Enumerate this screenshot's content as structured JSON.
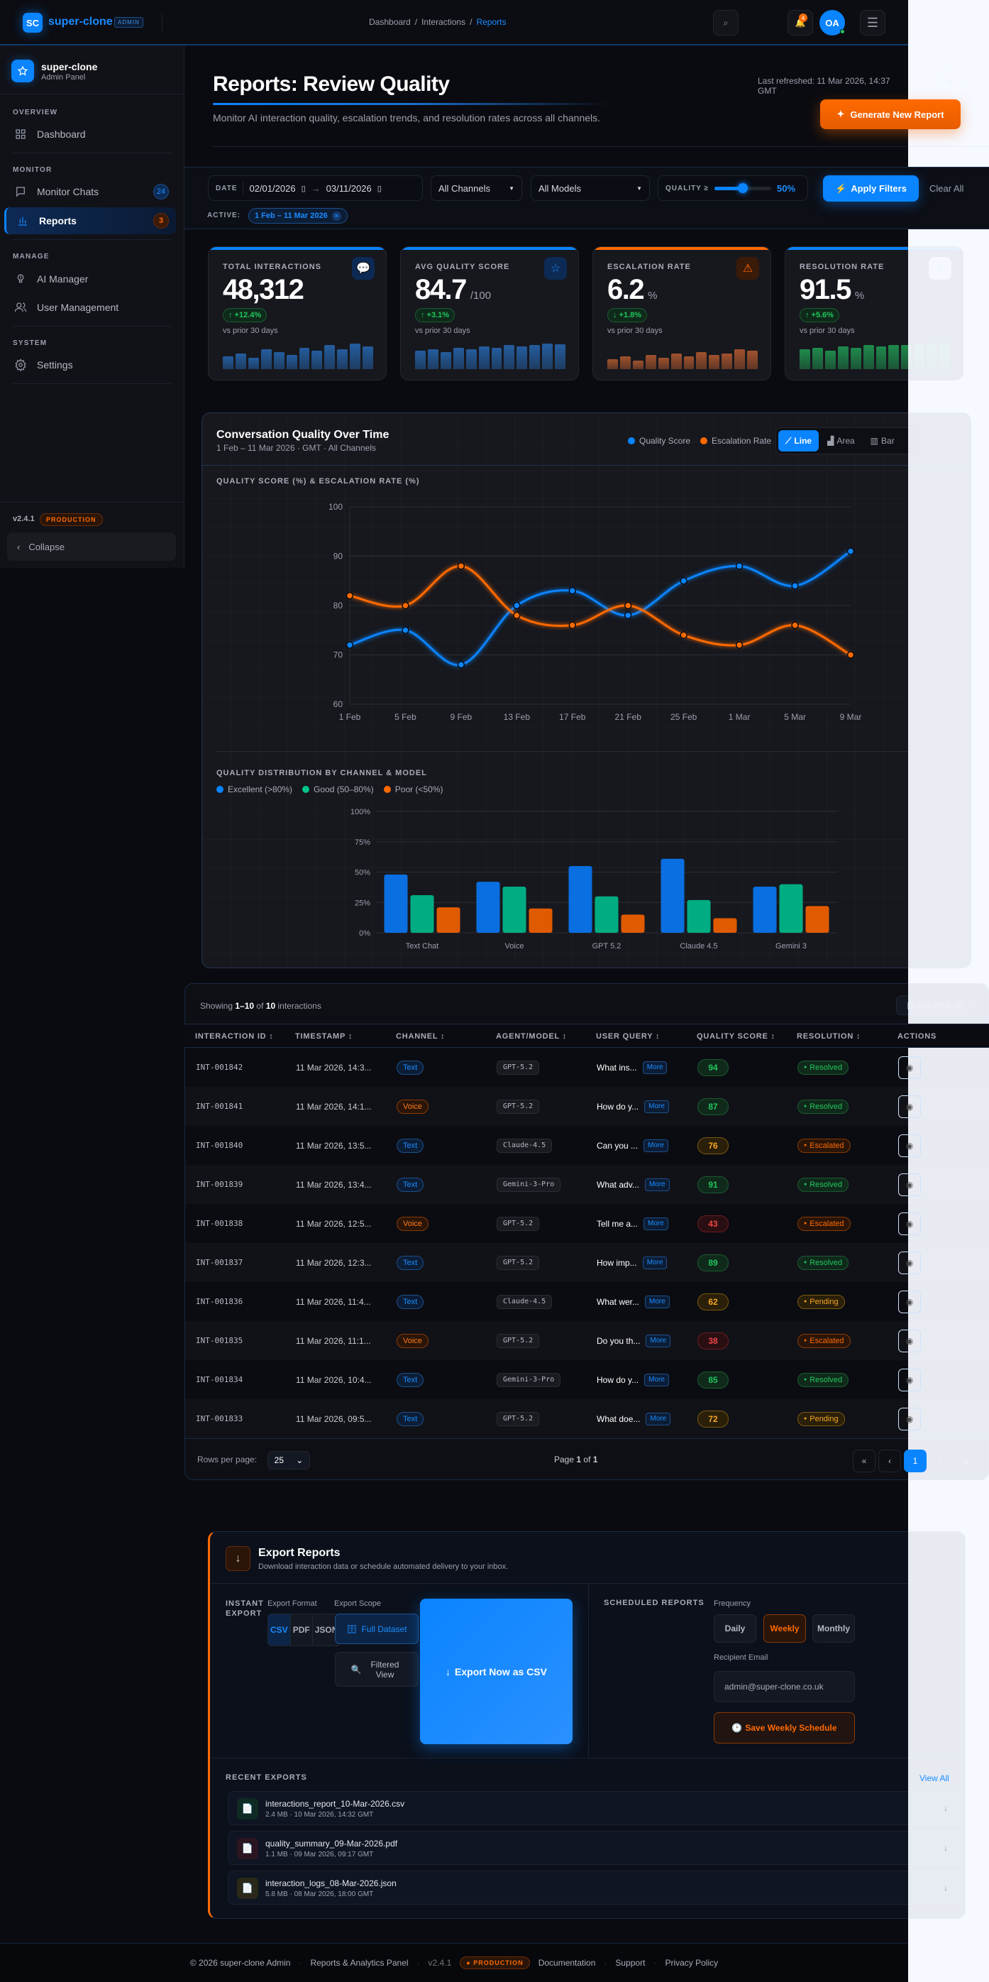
{
  "header": {
    "logo": "SC",
    "brand": "super-clone",
    "badge": "ADMIN",
    "breadcrumb": [
      "Dashboard",
      "Interactions",
      "Reports"
    ],
    "notifications": "4",
    "avatar": "OA"
  },
  "sidebar": {
    "brand": "super-clone",
    "subtitle": "Admin Panel",
    "sections": [
      "OVERVIEW",
      "MONITOR",
      "MANAGE",
      "SYSTEM"
    ],
    "items": [
      {
        "label": "Dashboard",
        "icon": "grid-icon"
      },
      {
        "label": "Monitor Chats",
        "icon": "chat-icon",
        "badge": "24"
      },
      {
        "label": "Reports",
        "icon": "bar-chart-icon",
        "badge": "3",
        "active": true
      },
      {
        "label": "AI Manager",
        "icon": "robot-icon"
      },
      {
        "label": "User Management",
        "icon": "users-icon"
      },
      {
        "label": "Settings",
        "icon": "gear-icon"
      }
    ],
    "version": "v2.4.1",
    "env": "PRODUCTION",
    "collapse": "Collapse"
  },
  "page": {
    "title": "Reports: Review Quality",
    "subtitle": "Monitor AI interaction quality, escalation trends, and resolution rates across all channels.",
    "last_refreshed": "Last refreshed: 11 Mar 2026, 14:37 GMT",
    "generate": "Generate New Report"
  },
  "filters": {
    "date_label": "DATE",
    "date_from": "02/01/2026",
    "date_to": "03/11/2026",
    "channel": "All Channels",
    "model": "All Models",
    "quality_label": "QUALITY ≥",
    "quality_value": "50%",
    "quality_fraction": 0.5,
    "apply": "Apply Filters",
    "clear": "Clear All",
    "active_label": "ACTIVE:",
    "active_chip": "1 Feb – 11 Mar 2026"
  },
  "stats": [
    {
      "title": "TOTAL INTERACTIONS",
      "value": "48,312",
      "unit": "",
      "delta": "↑ +12.4%",
      "prior": "vs prior 30 days",
      "accent": "#0a84ff",
      "sparkline": [
        52,
        64,
        46,
        82,
        70,
        58,
        88,
        76,
        100,
        82,
        106,
        94
      ]
    },
    {
      "title": "AVG QUALITY SCORE",
      "value": "84.7",
      "unit": "/100",
      "delta": "↑ +3.1%",
      "prior": "vs prior 30 days",
      "accent": "#0a84ff",
      "sparkline": [
        76,
        82,
        70,
        88,
        82,
        94,
        88,
        100,
        94,
        100,
        106,
        103
      ]
    },
    {
      "title": "ESCALATION RATE",
      "value": "6.2",
      "unit": "%",
      "delta": "↓ +1.8%",
      "prior": "vs prior 30 days",
      "accent": "#ff6a00",
      "sparkline": [
        40,
        52,
        34,
        58,
        46,
        64,
        52,
        70,
        58,
        64,
        82,
        76
      ]
    },
    {
      "title": "RESOLUTION RATE",
      "value": "91.5",
      "unit": "%",
      "delta": "↑ +5.6%",
      "prior": "vs prior 30 days",
      "accent": "#0a84ff",
      "sparkline": [
        82,
        88,
        76,
        94,
        88,
        100,
        94,
        100,
        100,
        103,
        106,
        106
      ]
    }
  ],
  "chart_panel": {
    "title": "Conversation Quality Over Time",
    "subtitle": "1 Feb – 11 Mar 2026 · GMT · All Channels",
    "toggles": [
      "Line",
      "Area",
      "Bar"
    ],
    "active_toggle": "Line"
  },
  "chart_data": [
    {
      "type": "line",
      "title": "QUALITY SCORE (%) & ESCALATION RATE (%)",
      "x": [
        "1 Feb",
        "5 Feb",
        "9 Feb",
        "13 Feb",
        "17 Feb",
        "21 Feb",
        "25 Feb",
        "1 Mar",
        "5 Mar",
        "9 Mar"
      ],
      "ylim": [
        60,
        100
      ],
      "yticks": [
        60,
        70,
        80,
        90,
        100
      ],
      "grid": true,
      "legend": "top-right",
      "series": [
        {
          "name": "Quality Score",
          "color": "#0a84ff",
          "values": [
            72,
            75,
            68,
            80,
            83,
            78,
            85,
            88,
            84,
            91
          ]
        },
        {
          "name": "Escalation Rate",
          "color": "#ff6a00",
          "values": [
            82,
            80,
            88,
            78,
            76,
            80,
            74,
            72,
            76,
            70
          ]
        }
      ]
    },
    {
      "type": "bar",
      "title": "QUALITY DISTRIBUTION BY CHANNEL & MODEL",
      "categories": [
        "Text Chat",
        "Voice",
        "GPT 5.2",
        "Claude 4.5",
        "Gemini 3"
      ],
      "ylim": [
        0,
        100
      ],
      "yticks": [
        "0%",
        "25%",
        "50%",
        "75%",
        "100%"
      ],
      "legend": "top-left",
      "series": [
        {
          "name": "Excellent (>80%)",
          "color": "#0a6fe0",
          "values": [
            48,
            42,
            55,
            61,
            38
          ]
        },
        {
          "name": "Good (50–80%)",
          "color": "#00ad82",
          "values": [
            31,
            38,
            30,
            27,
            40
          ]
        },
        {
          "name": "Poor (<50%)",
          "color": "#e05a00",
          "values": [
            21,
            20,
            15,
            12,
            22
          ]
        }
      ]
    }
  ],
  "table": {
    "showing_prefix": "Showing",
    "showing_range": "1–10",
    "showing_of": "of",
    "showing_total": "10",
    "showing_suffix": "interactions",
    "columns_button": "Columns (8)",
    "columns": [
      "INTERACTION ID",
      "TIMESTAMP",
      "CHANNEL",
      "AGENT/MODEL",
      "USER QUERY",
      "QUALITY SCORE",
      "RESOLUTION",
      "ACTIONS"
    ],
    "more": "More",
    "rows": [
      {
        "id": "INT-001842",
        "time": "11 Mar 2026, 14:3...",
        "channel": "Text",
        "model": "GPT-5.2",
        "query": "What ins...",
        "score": 94,
        "resolution": "Resolved"
      },
      {
        "id": "INT-001841",
        "time": "11 Mar 2026, 14:1...",
        "channel": "Voice",
        "model": "GPT-5.2",
        "query": "How do y...",
        "score": 87,
        "resolution": "Resolved"
      },
      {
        "id": "INT-001840",
        "time": "11 Mar 2026, 13:5...",
        "channel": "Text",
        "model": "Claude-4.5",
        "query": "Can you ...",
        "score": 76,
        "resolution": "Escalated"
      },
      {
        "id": "INT-001839",
        "time": "11 Mar 2026, 13:4...",
        "channel": "Text",
        "model": "Gemini-3-Pro",
        "query": "What adv...",
        "score": 91,
        "resolution": "Resolved"
      },
      {
        "id": "INT-001838",
        "time": "11 Mar 2026, 12:5...",
        "channel": "Voice",
        "model": "GPT-5.2",
        "query": "Tell me a...",
        "score": 43,
        "resolution": "Escalated"
      },
      {
        "id": "INT-001837",
        "time": "11 Mar 2026, 12:3...",
        "channel": "Text",
        "model": "GPT-5.2",
        "query": "How imp...",
        "score": 89,
        "resolution": "Resolved"
      },
      {
        "id": "INT-001836",
        "time": "11 Mar 2026, 11:4...",
        "channel": "Text",
        "model": "Claude-4.5",
        "query": "What wer...",
        "score": 62,
        "resolution": "Pending"
      },
      {
        "id": "INT-001835",
        "time": "11 Mar 2026, 11:1...",
        "channel": "Voice",
        "model": "GPT-5.2",
        "query": "Do you th...",
        "score": 38,
        "resolution": "Escalated"
      },
      {
        "id": "INT-001834",
        "time": "11 Mar 2026, 10:4...",
        "channel": "Text",
        "model": "Gemini-3-Pro",
        "query": "How do y...",
        "score": 85,
        "resolution": "Resolved"
      },
      {
        "id": "INT-001833",
        "time": "11 Mar 2026, 09:5...",
        "channel": "Text",
        "model": "GPT-5.2",
        "query": "What doe...",
        "score": 72,
        "resolution": "Pending"
      }
    ],
    "rows_per_page_label": "Rows per page:",
    "rows_per_page": "25",
    "page_prefix": "Page",
    "page": "1",
    "page_of": "of",
    "pages": "1"
  },
  "export": {
    "title": "Export Reports",
    "subtitle": "Download interaction data or schedule automated delivery to your inbox.",
    "instant_label": "INSTANT EXPORT",
    "format_label": "Export Format",
    "formats": [
      "CSV",
      "PDF",
      "JSON"
    ],
    "active_format": "CSV",
    "scope_label": "Export Scope",
    "scopes": [
      "Full Dataset",
      "Filtered View"
    ],
    "export_now": "Export Now as CSV",
    "scheduled_label": "SCHEDULED REPORTS",
    "frequency_label": "Frequency",
    "frequencies": [
      "Daily",
      "Weekly",
      "Monthly"
    ],
    "active_frequency": "Weekly",
    "email_label": "Recipient Email",
    "email": "admin@super-clone.co.uk",
    "save": "Save Weekly Schedule",
    "recent_label": "RECENT EXPORTS",
    "view_all": "View All",
    "recent": [
      {
        "name": "interactions_report_10-Mar-2026.csv",
        "meta": "2.4 MB · 10 Mar 2026, 14:32 GMT",
        "icon": "csv-file-icon"
      },
      {
        "name": "quality_summary_09-Mar-2026.pdf",
        "meta": "1.1 MB · 09 Mar 2026, 09:17 GMT",
        "icon": "pdf-file-icon"
      },
      {
        "name": "interaction_logs_08-Mar-2026.json",
        "meta": "5.8 MB · 08 Mar 2026, 18:00 GMT",
        "icon": "json-file-icon"
      }
    ]
  },
  "footer": {
    "copyright": "© 2026 super-clone Admin",
    "panel": "Reports & Analytics Panel",
    "version": "v2.4.1",
    "env": "PRODUCTION",
    "links": [
      "Documentation",
      "Support",
      "Privacy Policy"
    ]
  }
}
